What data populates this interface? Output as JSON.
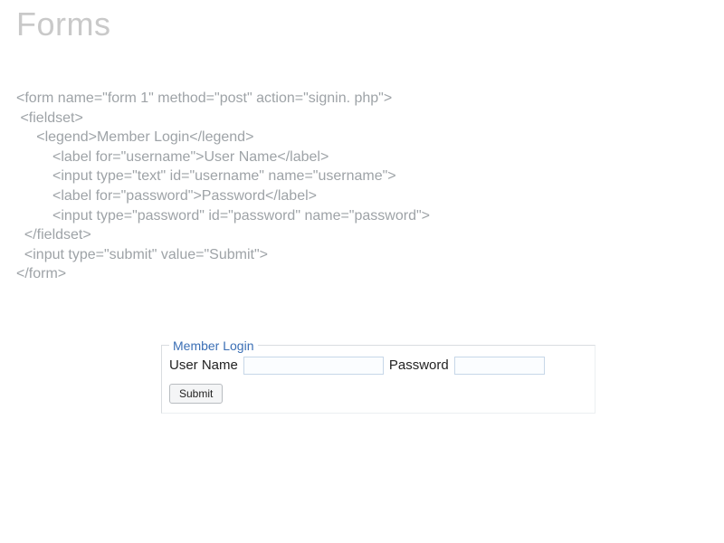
{
  "heading": "Forms",
  "code": {
    "l1": "<form name=\"form 1\" method=\"post\" action=\"signin. php\">",
    "l2": " <fieldset>",
    "l3": "     <legend>Member Login</legend>",
    "l4": "         <label for=\"username\">User Name</label>",
    "l5": "         <input type=\"text\" id=\"username\" name=\"username\">",
    "l6": "         <label for=\"password\">Password</label>",
    "l7": "         <input type=\"password\" id=\"password\" name=\"password\">",
    "l8": "  </fieldset>",
    "l9": "  <input type=\"submit\" value=\"Submit\">",
    "l10": "</form>"
  },
  "demo": {
    "legend": "Member Login",
    "username_label": "User Name",
    "password_label": "Password",
    "submit_label": "Submit"
  }
}
